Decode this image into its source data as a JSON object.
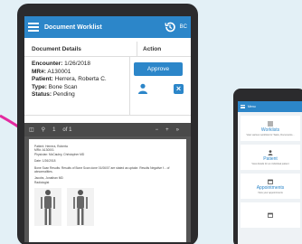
{
  "colors": {
    "brand": "#2c86c9",
    "accent_pink": "#e32a9f",
    "background": "#e3f0f6"
  },
  "tablet": {
    "header": {
      "title": "Document Worklist",
      "history_icon": "history-icon",
      "right_text": "BC"
    },
    "table": {
      "col_details": "Document Details",
      "col_action": "Action",
      "encounter_label": "Encounter:",
      "encounter_value": "1/26/2018",
      "mrn_label": "MR#:",
      "mrn_value": "A130001",
      "patient_label": "Patient:",
      "patient_value": "Herrera, Roberta C.",
      "type_label": "Type:",
      "type_value": "Bone Scan",
      "status_label": "Status:",
      "status_value": "Pending",
      "approve_label": "Approve"
    },
    "pdf": {
      "page_indicator": "1",
      "page_total": "of 1",
      "zoom_out": "−",
      "zoom_in": "+",
      "more": "»",
      "lines": [
        "Patient: Herrera, Roberta",
        "MR#: A130001",
        "Physician: McCauley, Christopher MD",
        "Date: 1/26/2018",
        "Bone Scan Results: Results of Bone Scan done 01/06/07 are stated as uptake. Results Negative f... of abnormalities.",
        "Jacobs, Jonathan MD",
        "Radiologist"
      ]
    }
  },
  "phone": {
    "header_title": "Menu",
    "cards": [
      {
        "icon": "list-icon",
        "title": "Worklists",
        "sub": "View various worklists for Tasks, Documents..."
      },
      {
        "icon": "person-icon",
        "title": "Patient",
        "sub": "View details for an individual patient"
      },
      {
        "icon": "calendar-icon",
        "title": "Appointments",
        "sub": "View your appointments"
      },
      {
        "icon": "calendar-icon",
        "title": "",
        "sub": ""
      }
    ]
  }
}
